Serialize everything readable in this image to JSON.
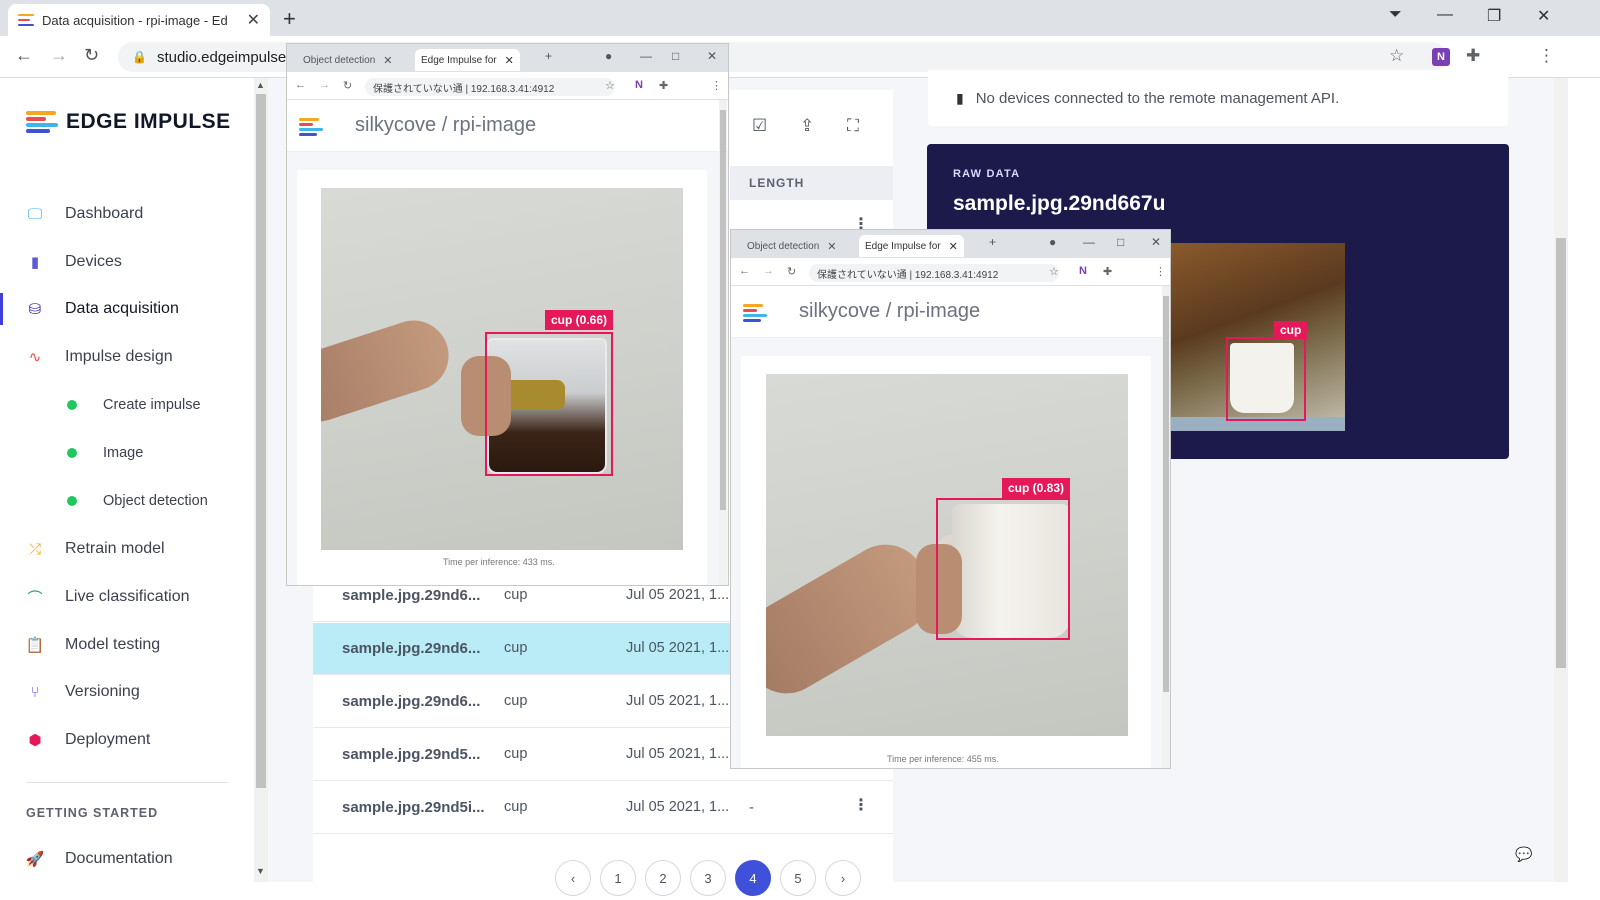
{
  "browser": {
    "tab_title": "Data acquisition - rpi-image - Ed",
    "url": "studio.edgeimpulse."
  },
  "sidebar": {
    "brand": "EDGE IMPULSE",
    "items": [
      {
        "label": "Dashboard"
      },
      {
        "label": "Devices"
      },
      {
        "label": "Data acquisition"
      },
      {
        "label": "Impulse design"
      },
      {
        "label": "Retrain model"
      },
      {
        "label": "Live classification"
      },
      {
        "label": "Model testing"
      },
      {
        "label": "Versioning"
      },
      {
        "label": "Deployment"
      }
    ],
    "sub_items": [
      {
        "label": "Create impulse"
      },
      {
        "label": "Image"
      },
      {
        "label": "Object detection"
      }
    ],
    "section_title": "GETTING STARTED",
    "docs_label": "Documentation"
  },
  "table": {
    "length_header": "LENGTH",
    "rows": [
      {
        "name": "sample.jpg.29nd6...",
        "label": "cup",
        "date": "Jul 05 2021, 1...",
        "length": ""
      },
      {
        "name": "sample.jpg.29nd6...",
        "label": "cup",
        "date": "Jul 05 2021, 1...",
        "length": ""
      },
      {
        "name": "sample.jpg.29nd6...",
        "label": "cup",
        "date": "Jul 05 2021, 1...",
        "length": ""
      },
      {
        "name": "sample.jpg.29nd5...",
        "label": "cup",
        "date": "Jul 05 2021, 1...",
        "length": ""
      },
      {
        "name": "sample.jpg.29nd5i...",
        "label": "cup",
        "date": "Jul 05 2021, 1...",
        "length": "-"
      }
    ],
    "pages": [
      "‹",
      "1",
      "2",
      "3",
      "4",
      "5",
      "›"
    ],
    "current_page": "4"
  },
  "devices_card": {
    "message": "No devices connected to the remote management API."
  },
  "raw_data": {
    "title": "RAW DATA",
    "sample_name": "sample.jpg.29nd667u",
    "box_label": "cup"
  },
  "popup1": {
    "tab_inactive": "Object detection",
    "tab_active": "Edge Impulse for",
    "url": "保護されていない通 | 192.168.3.41:4912",
    "crumb": "silkycove / rpi-image",
    "detection_label": "cup (0.66)",
    "timing": "Time per inference: 433 ms."
  },
  "popup2": {
    "tab_inactive": "Object detection",
    "tab_active": "Edge Impulse for",
    "url": "保護されていない通 | 192.168.3.41:4912",
    "crumb": "silkycove / rpi-image",
    "detection_label": "cup (0.83)",
    "timing": "Time per inference: 455 ms."
  },
  "colors": {
    "accent": "#3f51d8",
    "selected_row": "#b9ecf7",
    "detection": "#e3195a",
    "raw_panel": "#1b1a4b"
  }
}
